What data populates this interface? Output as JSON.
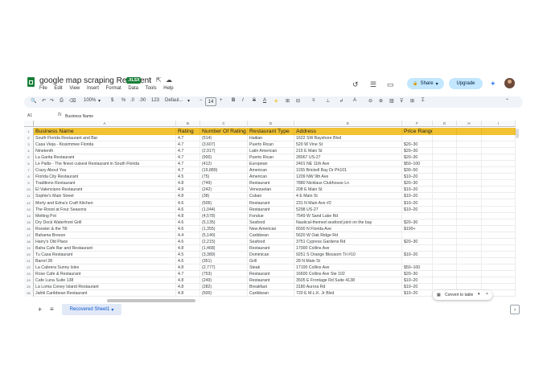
{
  "doc": {
    "title": "google map scraping Resturent",
    "badge": ".XLSX",
    "star_icon": "☆",
    "move_icon": "⇱",
    "cloud_icon": "☁"
  },
  "menu": [
    "File",
    "Edit",
    "View",
    "Insert",
    "Format",
    "Data",
    "Tools",
    "Help"
  ],
  "header": {
    "history_icon": "↺",
    "comment_icon": "☰",
    "meet_icon": "▭",
    "share_label": "Share",
    "share_dropdown_icon": "▾",
    "lock_icon": "🔒",
    "upgrade_label": "Upgrade",
    "gemini_icon": "✦"
  },
  "toolbar": {
    "search_icon": "🔍",
    "undo_icon": "↶",
    "redo_icon": "↷",
    "print_icon": "⎙",
    "paint_format_icon": "⌫",
    "zoom": "100%",
    "zoom_dropdown_icon": "▾",
    "currency": "$",
    "percent": "%",
    "decrease_decimals": ".0",
    "increase_decimals": ".00",
    "more_formats": "123",
    "font": "Defaul...",
    "font_dropdown_icon": "▾",
    "font_size": "14",
    "minus": "−",
    "plus": "+",
    "bold": "B",
    "italic": "I",
    "strike": "S",
    "text_color": "A",
    "fill_icon": "◈",
    "borders_icon": "⊞",
    "merge_icon": "⊟",
    "align_icon": "≡",
    "valign_icon": "⊥",
    "wrap_icon": "↲",
    "rotate_icon": "A",
    "link_icon": "⊖",
    "comment_add_icon": "⊕",
    "chart_icon": "▥",
    "filter_icon": "⊽",
    "filter_views_icon": "⊞",
    "functions_icon": "Σ",
    "collapse_icon": "⌃"
  },
  "formula_bar": {
    "name_box": "A1",
    "fx": "fx",
    "value": "Business Name"
  },
  "columns": [
    "A",
    "B",
    "C",
    "D",
    "E",
    "F",
    "G",
    "H",
    "I"
  ],
  "table": {
    "headers": [
      "Business Name",
      "Rating",
      "Number Of Rating",
      "Restaurant Type",
      "Address",
      "Price Range"
    ],
    "rows": [
      [
        "South Florida Restaurant and Bar",
        "4.7",
        "(514)",
        "Haitian",
        "1622 SW Bayshore Blvd",
        ""
      ],
      [
        "Casa Vieja - Kissimmee Florida",
        "4.7",
        "(3,607)",
        "Puerto Rican",
        "520 W Vine St",
        "$20–30"
      ],
      [
        "Ninetenth",
        "4.7",
        "(2,917)",
        "Latin American",
        "215 E Main St",
        "$20–30"
      ],
      [
        "La Garita Restaurant",
        "4.7",
        "(900)",
        "Puerto Rican",
        "28067 US-27",
        "$20–30"
      ],
      [
        "Le Pallis - The finest cuisest Restaurant in South Florida",
        "4.7",
        "(412)",
        "European",
        "2401 NE 11th Ave",
        "$50–100"
      ],
      [
        "Crazy About You",
        "4.7",
        "(19,889)",
        "American",
        "1155 Brickell Bay Dr Ph101",
        "$30–50"
      ],
      [
        "Florida City Restaurant",
        "4.5",
        "(75)",
        "American",
        "1209 NW 9th Ave",
        "$10–20"
      ],
      [
        "Traditions Restaurant",
        "4.8",
        "(749)",
        "Restaurant",
        "7880 Nicklaus Clubhouse Ln",
        "$20–30"
      ],
      [
        "El Valenciano Restaurant",
        "4.9",
        "(242)",
        "Venezuelan",
        "208 E Main St",
        "$10–20"
      ],
      [
        "Sophie's Main Street",
        "4.8",
        "(38)",
        "Cuban",
        "4 E Main St",
        "$10–20"
      ],
      [
        "Morty and Edna's Craft Kitchen",
        "4.6",
        "(506)",
        "Restaurant",
        "231 N Main Ave #2",
        "$10–20"
      ],
      [
        "The Roost at Four Seasons",
        "4.6",
        "(1,044)",
        "Restaurant",
        "5298 US-27",
        "$10–20"
      ],
      [
        "Melting Pot",
        "4.8",
        "(4,578)",
        "Fondue",
        "7549 W Sand Lake Rd",
        ""
      ],
      [
        "Dry Dock Waterfront Grill",
        "4.6",
        "(5,135)",
        "Seafood",
        "Nautical-themed seafood joint on the bay",
        "$20–30"
      ],
      [
        "Rooster & the Till",
        "4.6",
        "(1,355)",
        "New American",
        "6500 N Florida Ave",
        "$100+"
      ],
      [
        "Bahama Breeze",
        "4.4",
        "(5,140)",
        "Caribbean",
        "5620 W Oak Ridge Rd",
        ""
      ],
      [
        "Harry's Old Place",
        "4.6",
        "(2,215)",
        "Seafood",
        "3751 Cypress Gardens Rd",
        "$20–30"
      ],
      [
        "Baha Cafe Bar and Restaurant",
        "4.8",
        "(1,468)",
        "Restaurant",
        "17000 Collins Ave",
        ""
      ],
      [
        "Tu Casa Restaurant",
        "4.5",
        "(3,389)",
        "Dominican",
        "9251 S Orange Blossom Trl #10",
        "$10–20"
      ],
      [
        "Barrel 28",
        "4.6",
        "(351)",
        "Grill",
        "28 N Main St",
        ""
      ],
      [
        "La Cabrera Sunny Isles",
        "4.8",
        "(2,777)",
        "Steak",
        "17100 Collins Ave",
        "$50–100"
      ],
      [
        "Rose Cafe & Restaurant",
        "4.7",
        "(753)",
        "Restaurant",
        "16600 Collins Ave Ste 102",
        "$20–30"
      ],
      [
        "Cafe Luna Suite 138",
        "4.8",
        "(249)",
        "Restaurant",
        "3505 E Frontage Rd Suite 4138",
        "$10–20"
      ],
      [
        "La Loma Coney Island Restaurant",
        "4.8",
        "(282)",
        "Breakfast",
        "3180 Aurora Rd",
        "$10–20"
      ],
      [
        "Jahiti Caribbean Restaurant",
        "4.8",
        "(500)",
        "Caribbean",
        "720 E M.L.K. Jr Blvd",
        "$10–20"
      ]
    ]
  },
  "convert_popup": {
    "icon": "▦",
    "label": "Convert to table",
    "dropdown_icon": "▾",
    "close_icon": "×"
  },
  "sheets": {
    "add_icon": "+",
    "all_icon": "≡",
    "tab_label": "Recovered Sheet1",
    "tab_dropdown_icon": "▾",
    "explore_icon": "›"
  }
}
